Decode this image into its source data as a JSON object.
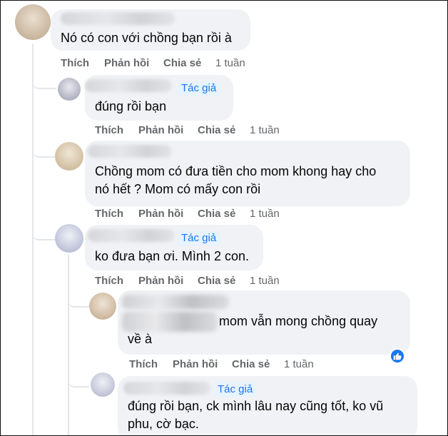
{
  "comments": [
    {
      "text_lines": [
        "Nó có con với chồng bạn rồi à"
      ]
    },
    {
      "author_badge": "Tác giả",
      "text_lines": [
        "đúng rồi bạn"
      ]
    },
    {
      "text_lines": [
        "Chồng mom có đưa tiền cho mom khong hay cho",
        "nó hết ? Mom có mấy con rồi"
      ]
    },
    {
      "author_badge": "Tác giả",
      "text_lines": [
        "ko đưa bạn ơi. Mình 2 con."
      ]
    },
    {
      "text_lines": [
        "mom vẫn mong chồng quay",
        "về à"
      ]
    },
    {
      "author_badge": "Tác giả",
      "text_lines": [
        "đúng rồi bạn, ck mình lâu nay cũng tốt, ko vũ",
        "phu, cờ bạc."
      ]
    }
  ],
  "actions": {
    "like": "Thích",
    "reply": "Phản hồi",
    "share": "Chia sẻ",
    "time": "1 tuần"
  },
  "colors": {
    "bubble": "#f0f2f5",
    "action_text": "#65676b",
    "author_badge": "#1877f2",
    "like_badge": "#1877f2"
  },
  "icons": {
    "reaction": "thumbs-up-icon"
  }
}
